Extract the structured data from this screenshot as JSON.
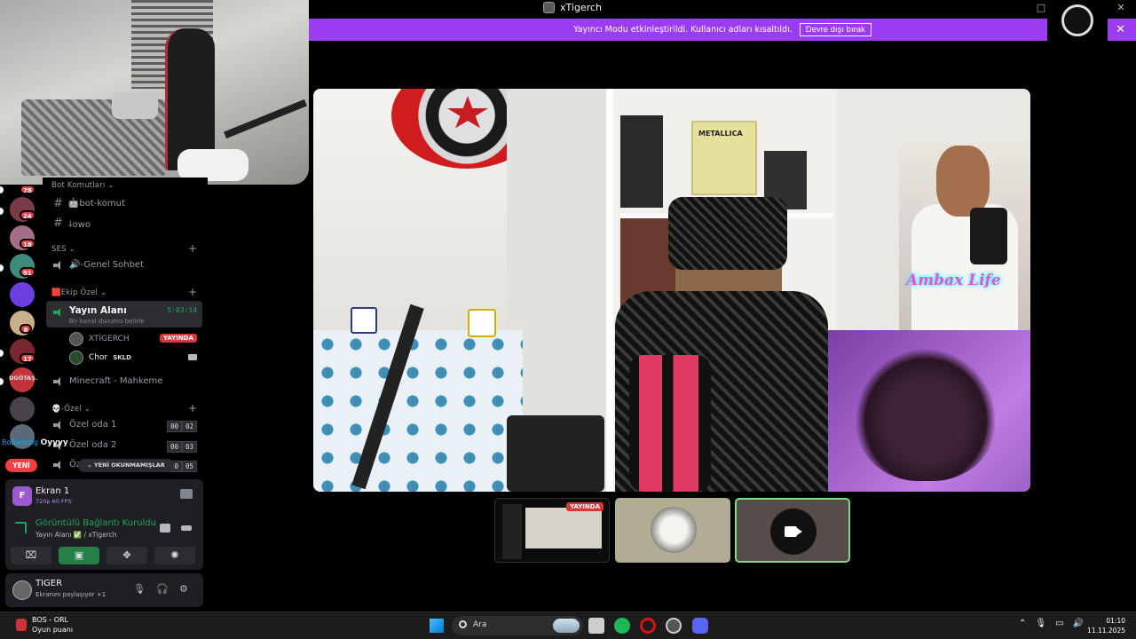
{
  "window": {
    "title": "xTigerch",
    "controls": [
      "□",
      "—",
      "□",
      "✕"
    ]
  },
  "banner": {
    "message": "Yayıncı Modu etkinleştirildi. Kullanıcı adları kısaltıldı.",
    "button": "Devre dışı bırak",
    "close": "✕"
  },
  "servers": {
    "badges": [
      "78",
      "24",
      "18",
      "91",
      "8",
      "17"
    ],
    "label_dgotas": "DGÖTAŞ.",
    "new_pill": "YENİ"
  },
  "channels": {
    "bot_category": "Bot Komutları",
    "bot_komut": "🤖bot-komut",
    "owo": "⸸owo",
    "ses_category": "SES",
    "genel_sohbet": "🔊-Genel Sohbet",
    "ekip_category": "🟥Ekip Özel",
    "yayin_alani": "Yayın Alanı",
    "yayin_time": "5:03:14",
    "yayin_status": "Bir kanal durumu belirle",
    "user1": "XTİGERCH",
    "user1_badge": "YAYINDA",
    "user2": "Chor",
    "user2_tag": "SKLD",
    "minecraft": "Minecraft - Mahkeme",
    "ozel_category": "💀-Özel",
    "ozel1": "Özel oda 1",
    "ozel1_cnt": [
      "00",
      "02"
    ],
    "ozel2": "Özel oda 2",
    "ozel2_cnt": [
      "00",
      "03"
    ],
    "ozel3": "Öz",
    "ozel3_cnt": [
      "00",
      "05"
    ],
    "unread": "YENİ OKUNMAMIŞLAR",
    "floating_user": "BoBarking",
    "floating_text": "Oyyyy"
  },
  "screen_panel": {
    "icon_letter": "F",
    "title": "Ekran 1",
    "sub": "720p 60 FPS"
  },
  "connection": {
    "title": "Görüntülü Bağlantı Kuruldu",
    "sub": "Yayın Alanı ✅ / xTigerch"
  },
  "user_panel": {
    "name": "TIGER",
    "sub": "Ekranını paylaşıyor +1"
  },
  "stream": {
    "metallica": "METALLICA",
    "overlay_text": "Ambax Life"
  },
  "thumbs": {
    "live": "YAYINDA"
  },
  "taskbar": {
    "game_title": "BOS - ORL",
    "game_sub": "Oyun puanı",
    "search": "Ara",
    "time": "01:10",
    "date": "11.11.2025"
  }
}
